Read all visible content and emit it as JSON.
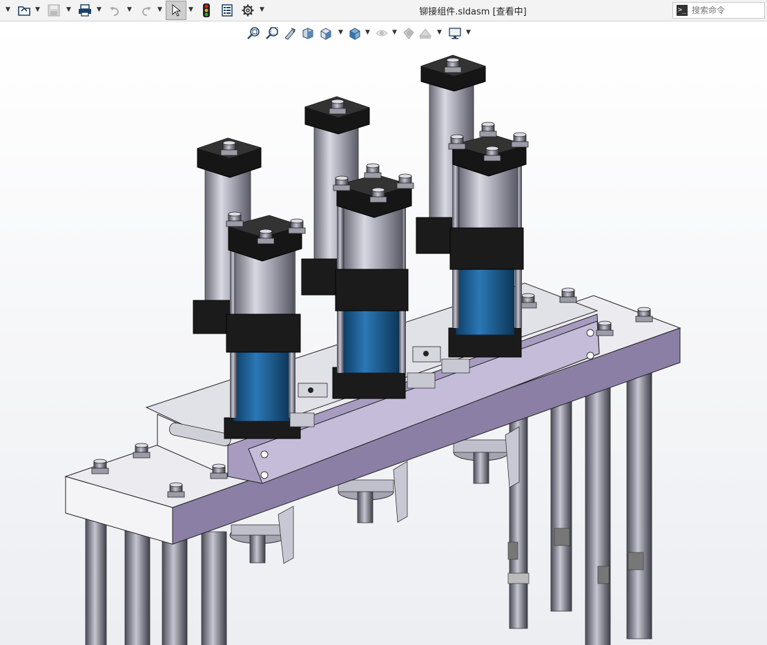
{
  "window": {
    "title": "铆接组件.sldasm [查看中]"
  },
  "toolbar": {
    "items": [
      {
        "icon": "new-dropdown-icon"
      },
      {
        "icon": "open-icon"
      },
      {
        "icon": "save-icon"
      },
      {
        "icon": "print-icon"
      },
      {
        "icon": "undo-icon"
      },
      {
        "icon": "redo-icon"
      },
      {
        "icon": "select-cursor-icon"
      },
      {
        "icon": "traffic-light-icon"
      },
      {
        "icon": "file-properties-icon"
      },
      {
        "icon": "options-gear-icon"
      }
    ]
  },
  "search": {
    "placeholder": "搜索命令"
  },
  "heads_up_toolbar": {
    "items": [
      {
        "icon": "zoom-to-fit-icon"
      },
      {
        "icon": "zoom-to-area-icon"
      },
      {
        "icon": "previous-view-icon"
      },
      {
        "icon": "section-view-icon"
      },
      {
        "icon": "view-orientation-icon"
      },
      {
        "icon": "display-style-icon"
      },
      {
        "icon": "hide-show-items-icon"
      },
      {
        "icon": "edit-appearance-icon"
      },
      {
        "icon": "apply-scene-icon"
      },
      {
        "icon": "view-settings-icon"
      }
    ]
  },
  "colors": {
    "toolbar_bg": "#f3f3f3",
    "plate": "#8b7fa6",
    "plate_top": "#e9e9ef",
    "cylinder_blue": "#1d5f93",
    "black_block": "#1b1b1b",
    "steel": "#a9a9b6"
  }
}
